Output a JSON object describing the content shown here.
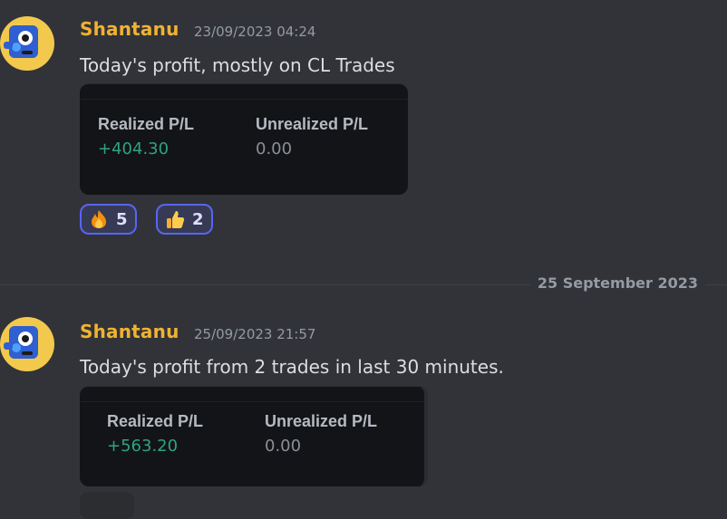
{
  "messages": [
    {
      "username": "Shantanu",
      "timestamp": "23/09/2023 04:24",
      "text": "Today's profit, mostly on CL Trades",
      "embed": {
        "realized_label": "Realized P/L",
        "realized_value": "+404.30",
        "unrealized_label": "Unrealized P/L",
        "unrealized_value": "0.00"
      },
      "reactions": [
        {
          "emoji": "fire-emoji",
          "count": "5"
        },
        {
          "emoji": "thumbs-up-emoji",
          "count": "2"
        }
      ]
    },
    {
      "username": "Shantanu",
      "timestamp": "25/09/2023 21:57",
      "text": "Today's profit from 2 trades in last 30 minutes.",
      "embed": {
        "realized_label": "Realized P/L",
        "realized_value": "+563.20",
        "unrealized_label": "Unrealized P/L",
        "unrealized_value": "0.00"
      }
    }
  ],
  "date_divider": "25 September 2023",
  "colors": {
    "background": "#313338",
    "username": "#f0b232",
    "profit": "#2ea37f",
    "reaction_border": "#5865f2"
  }
}
